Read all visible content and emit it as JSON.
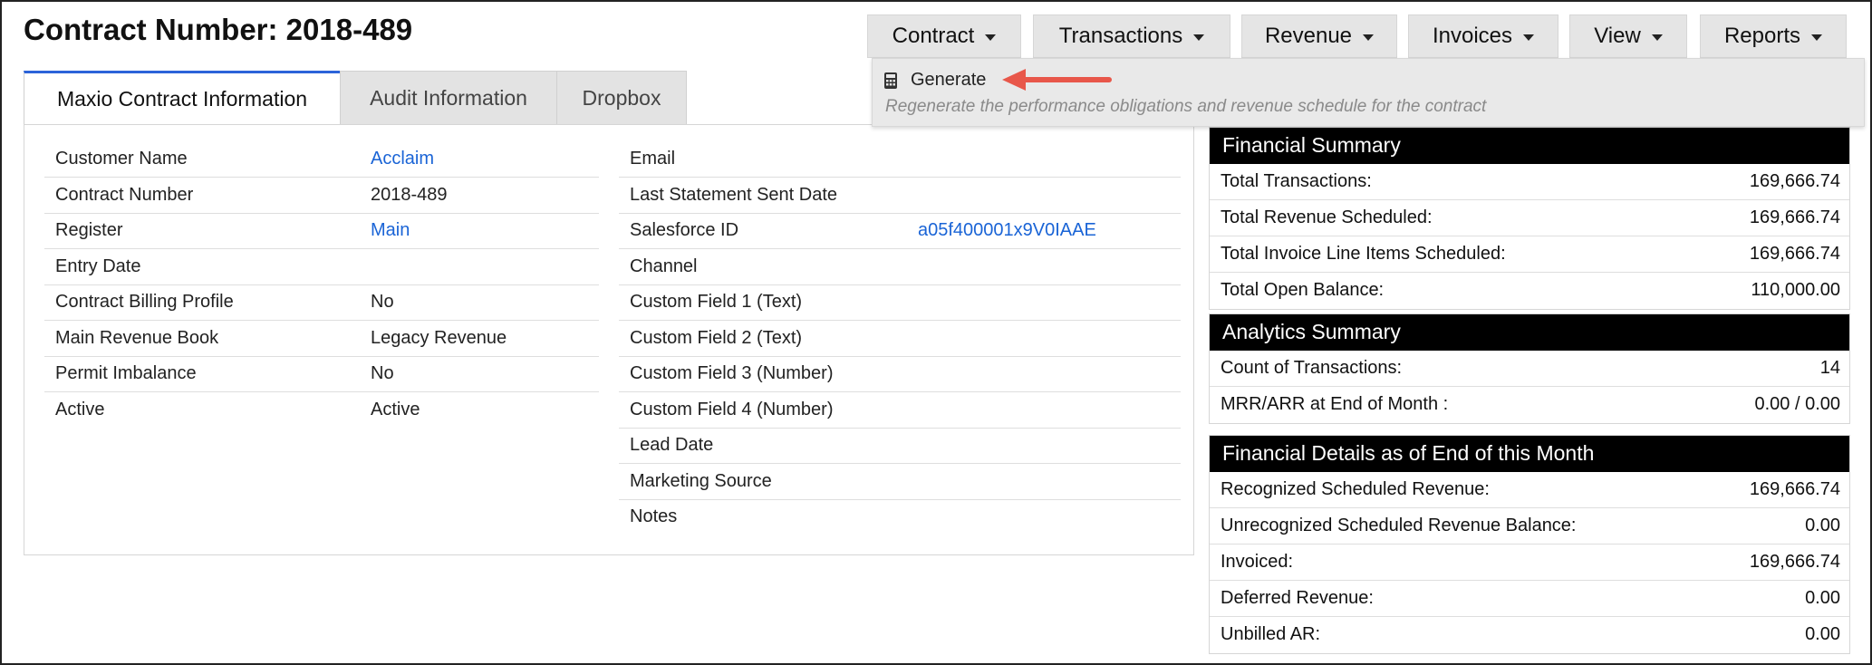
{
  "page_title": "Contract Number: 2018-489",
  "menus": [
    "Contract",
    "Transactions",
    "Revenue",
    "Invoices",
    "View",
    "Reports"
  ],
  "dropdown": {
    "item_label": "Generate",
    "item_icon": "calculator-icon",
    "item_description": "Regenerate the performance obligations and revenue schedule for the contract"
  },
  "tabs": [
    "Maxio Contract Information",
    "Audit Information",
    "Dropbox"
  ],
  "left_fields": [
    {
      "label": "Customer Name",
      "value": "Acclaim",
      "link": true
    },
    {
      "label": "Contract Number",
      "value": "2018-489",
      "link": false
    },
    {
      "label": "Register",
      "value": "Main",
      "link": true
    },
    {
      "label": "Entry Date",
      "value": "",
      "link": false
    },
    {
      "label": "Contract Billing Profile",
      "value": "No",
      "link": false
    },
    {
      "label": "Main Revenue Book",
      "value": "Legacy Revenue",
      "link": false
    },
    {
      "label": "Permit Imbalance",
      "value": "No",
      "link": false
    },
    {
      "label": "Active",
      "value": "Active",
      "link": false
    }
  ],
  "right_fields": [
    {
      "label": "Email",
      "value": ""
    },
    {
      "label": "Last Statement Sent Date",
      "value": ""
    },
    {
      "label": "Salesforce ID",
      "value": "a05f400001x9V0IAAE",
      "link": true
    },
    {
      "label": "Channel",
      "value": ""
    },
    {
      "label": "Custom Field 1 (Text)",
      "value": ""
    },
    {
      "label": "Custom Field 2 (Text)",
      "value": ""
    },
    {
      "label": "Custom Field 3 (Number)",
      "value": ""
    },
    {
      "label": "Custom Field 4 (Number)",
      "value": ""
    },
    {
      "label": "Lead Date",
      "value": ""
    },
    {
      "label": "Marketing Source",
      "value": ""
    },
    {
      "label": "Notes",
      "value": ""
    }
  ],
  "financial_summary": {
    "title": "Financial Summary",
    "rows": [
      {
        "label": "Total Transactions:",
        "value": "169,666.74"
      },
      {
        "label": "Total Revenue Scheduled:",
        "value": "169,666.74"
      },
      {
        "label": "Total Invoice Line Items Scheduled:",
        "value": "169,666.74"
      },
      {
        "label": "Total Open Balance:",
        "value": "110,000.00"
      }
    ]
  },
  "analytics_summary": {
    "title": "Analytics Summary",
    "rows": [
      {
        "label": "Count of Transactions:",
        "value": "14"
      },
      {
        "label": "MRR/ARR at End of Month :",
        "value": "0.00 / 0.00"
      }
    ]
  },
  "financial_details": {
    "title": "Financial Details as of End of this Month",
    "rows": [
      {
        "label": "Recognized Scheduled Revenue:",
        "value": "169,666.74"
      },
      {
        "label": "Unrecognized Scheduled Revenue Balance:",
        "value": "0.00"
      },
      {
        "label": "Invoiced:",
        "value": "169,666.74"
      },
      {
        "label": "Deferred Revenue:",
        "value": "0.00"
      },
      {
        "label": "Unbilled AR:",
        "value": "0.00"
      }
    ]
  },
  "colors": {
    "link": "#1a64d6",
    "tab_accent": "#2b63d9",
    "annotation_arrow": "#e8574a"
  }
}
